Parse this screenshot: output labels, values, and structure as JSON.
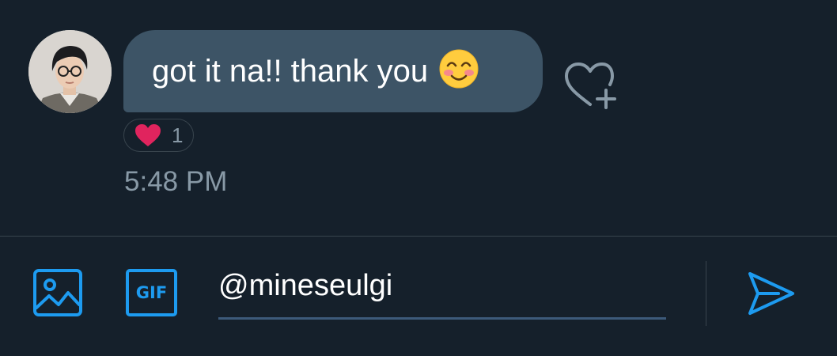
{
  "colors": {
    "background": "#15202b",
    "bubble": "#3d5466",
    "accent": "#1d9bf0",
    "muted": "#8899a6",
    "heart": "#e0245e"
  },
  "message": {
    "text": "got it na!! thank you",
    "emoji": "smiling-face-with-blushing-cheeks",
    "reaction": {
      "icon": "red-heart",
      "count": "1"
    },
    "timestamp": "5:48 PM"
  },
  "composer": {
    "input_value": "@mineseulgi",
    "gif_label": "GIF",
    "icons": [
      "image-icon",
      "gif-icon",
      "send-icon"
    ]
  }
}
